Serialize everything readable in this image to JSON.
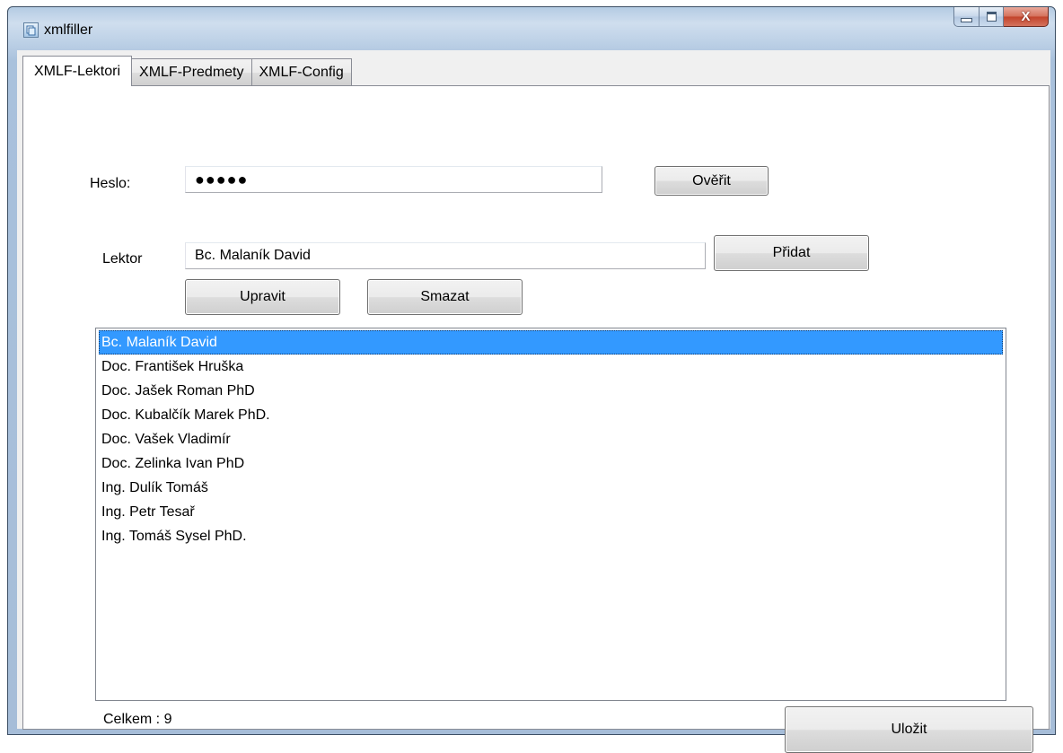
{
  "window": {
    "title": "xmlfiller",
    "controls": {
      "minimize": "minimize",
      "maximize": "maximize",
      "close": "X"
    }
  },
  "tabs": [
    {
      "label": "XMLF-Lektori",
      "active": true
    },
    {
      "label": "XMLF-Predmety",
      "active": false
    },
    {
      "label": "XMLF-Config",
      "active": false
    }
  ],
  "form": {
    "password_label": "Heslo:",
    "password_value": "●●●●●",
    "verify_button": "Ověřit",
    "lecturer_label": "Lektor",
    "lecturer_value": "Bc. Malaník David",
    "add_button": "Přidat",
    "edit_button": "Upravit",
    "delete_button": "Smazat"
  },
  "lecturers": {
    "items": [
      "Bc. Malaník David",
      "Doc. František Hruška",
      "Doc. Jašek Roman PhD",
      "Doc. Kubalčík Marek PhD.",
      "Doc. Vašek Vladimír",
      "Doc. Zelinka Ivan PhD",
      "Ing. Dulík Tomáš",
      "Ing. Petr Tesař",
      "Ing. Tomáš Sysel PhD."
    ],
    "selected_index": 0
  },
  "footer": {
    "total_label": "Celkem : 9",
    "save_button": "Uložit"
  },
  "colors": {
    "selection": "#3399ff",
    "close_button": "#c2422a",
    "window_frame": "#a9c1dc"
  }
}
